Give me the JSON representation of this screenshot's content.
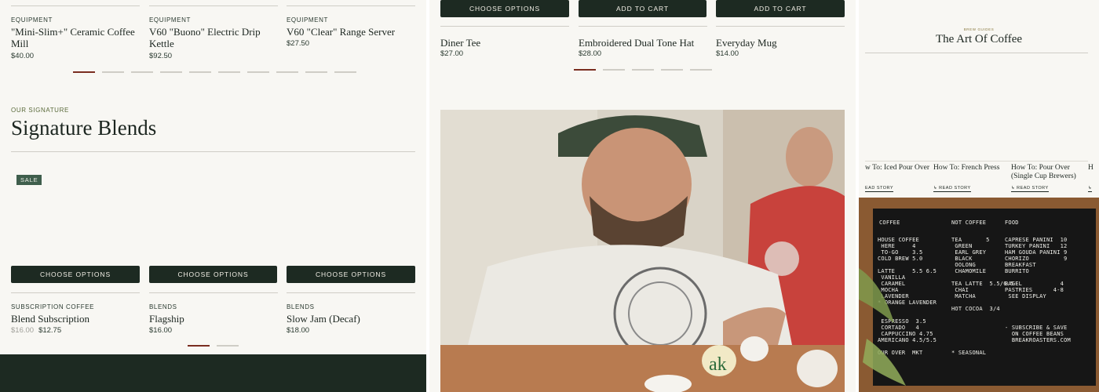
{
  "left": {
    "top_products": [
      {
        "category": "EQUIPMENT",
        "title": "\"Mini-Slim+\" Ceramic Coffee Mill",
        "price": "$40.00"
      },
      {
        "category": "EQUIPMENT",
        "title": "V60 \"Buono\" Electric Drip Kettle",
        "price": "$92.50"
      },
      {
        "category": "EQUIPMENT",
        "title": "V60 \"Clear\" Range Server",
        "price": "$27.50"
      }
    ],
    "section_eyebrow": "OUR SIGNATURE",
    "section_title": "Signature Blends",
    "sale_badge": "SALE",
    "choose_options": "CHOOSE OPTIONS",
    "products": [
      {
        "category": "SUBSCRIPTION COFFEE",
        "title": "Blend Subscription",
        "old_price": "$16.00",
        "price": "$12.75"
      },
      {
        "category": "BLENDS",
        "title": "Flagship",
        "price": "$16.00"
      },
      {
        "category": "BLENDS",
        "title": "Slow Jam (Decaf)",
        "price": "$18.00"
      }
    ]
  },
  "middle": {
    "buttons": [
      "CHOOSE OPTIONS",
      "ADD TO CART",
      "ADD TO CART"
    ],
    "products": [
      {
        "title": "Diner Tee",
        "price": "$27.00"
      },
      {
        "title": "Embroidered Dual Tone Hat",
        "price": "$28.00"
      },
      {
        "title": "Everyday Mug",
        "price": "$14.00"
      }
    ],
    "photo_alt": "Barista cupping coffee"
  },
  "right": {
    "eyebrow": "BREW GUIDES",
    "title": "The Art Of Coffee",
    "stories": [
      {
        "title": "w To: Iced Pour Over",
        "link": "EAD STORY"
      },
      {
        "title": "How To: French Press",
        "link": "READ STORY"
      },
      {
        "title": "How To: Pour Over (Single Cup Brewers)",
        "title_line1": "How To: Pour Over",
        "title_line2": "(Single Cup Brewers)",
        "link": "READ STORY"
      },
      {
        "title": "H",
        "link": ""
      }
    ],
    "menu_board": {
      "col1_header": "COFFEE",
      "col2_header": "NOT COFFEE",
      "col3_header": "FOOD",
      "col1_lines": [
        "HOUSE COFFEE",
        " HERE     4",
        " TO-GO    3.5",
        "COLD BREW 5.0",
        "",
        "LATTE     5.5 6.5",
        " VANILLA",
        " CARAMEL",
        " MOCHA",
        " LAVENDER",
        "* ORANGE LAVENDER",
        "",
        "",
        " ESPRESSO  3.5",
        " CORTADO   4",
        " CAPPUCCINO 4.75",
        "AMERICANO 4.5/5.5",
        "",
        "OUR OVER  MKT"
      ],
      "col2_lines": [
        "TEA       5",
        " GREEN",
        " EARL GREY",
        " BLACK",
        " OOLONG",
        " CHAMOMILE",
        "",
        "TEA LATTE  5.5/6.5",
        " CHAI",
        " MATCHA",
        "",
        "HOT COCOA  3/4",
        "",
        "",
        "",
        "",
        "",
        "",
        "* SEASONAL"
      ],
      "col3_lines": [
        "CAPRESE PANINI  10",
        "TURKEY PANINI   12",
        "HAM GOUDA PANINI 9",
        "CHORIZO          9",
        "BREAKFAST",
        "BURRITO",
        "",
        "BAGEL           4",
        "PASTRIES      4-8",
        " SEE DISPLAY",
        "",
        "",
        "",
        "",
        "- SUBSCRIBE & SAVE",
        "  ON COFFEE BEANS",
        "  BREAKROASTERS.COM"
      ]
    }
  },
  "carousel": {
    "left_top_count": 10,
    "left_top_active": 0,
    "left_bottom_count": 2,
    "left_bottom_active": 0,
    "mid_count": 5,
    "mid_active": 0
  },
  "colors": {
    "accent": "#1d2a22",
    "active_dot": "#7a2d20",
    "background": "#f8f7f3",
    "badge": "#3f5e4c"
  }
}
